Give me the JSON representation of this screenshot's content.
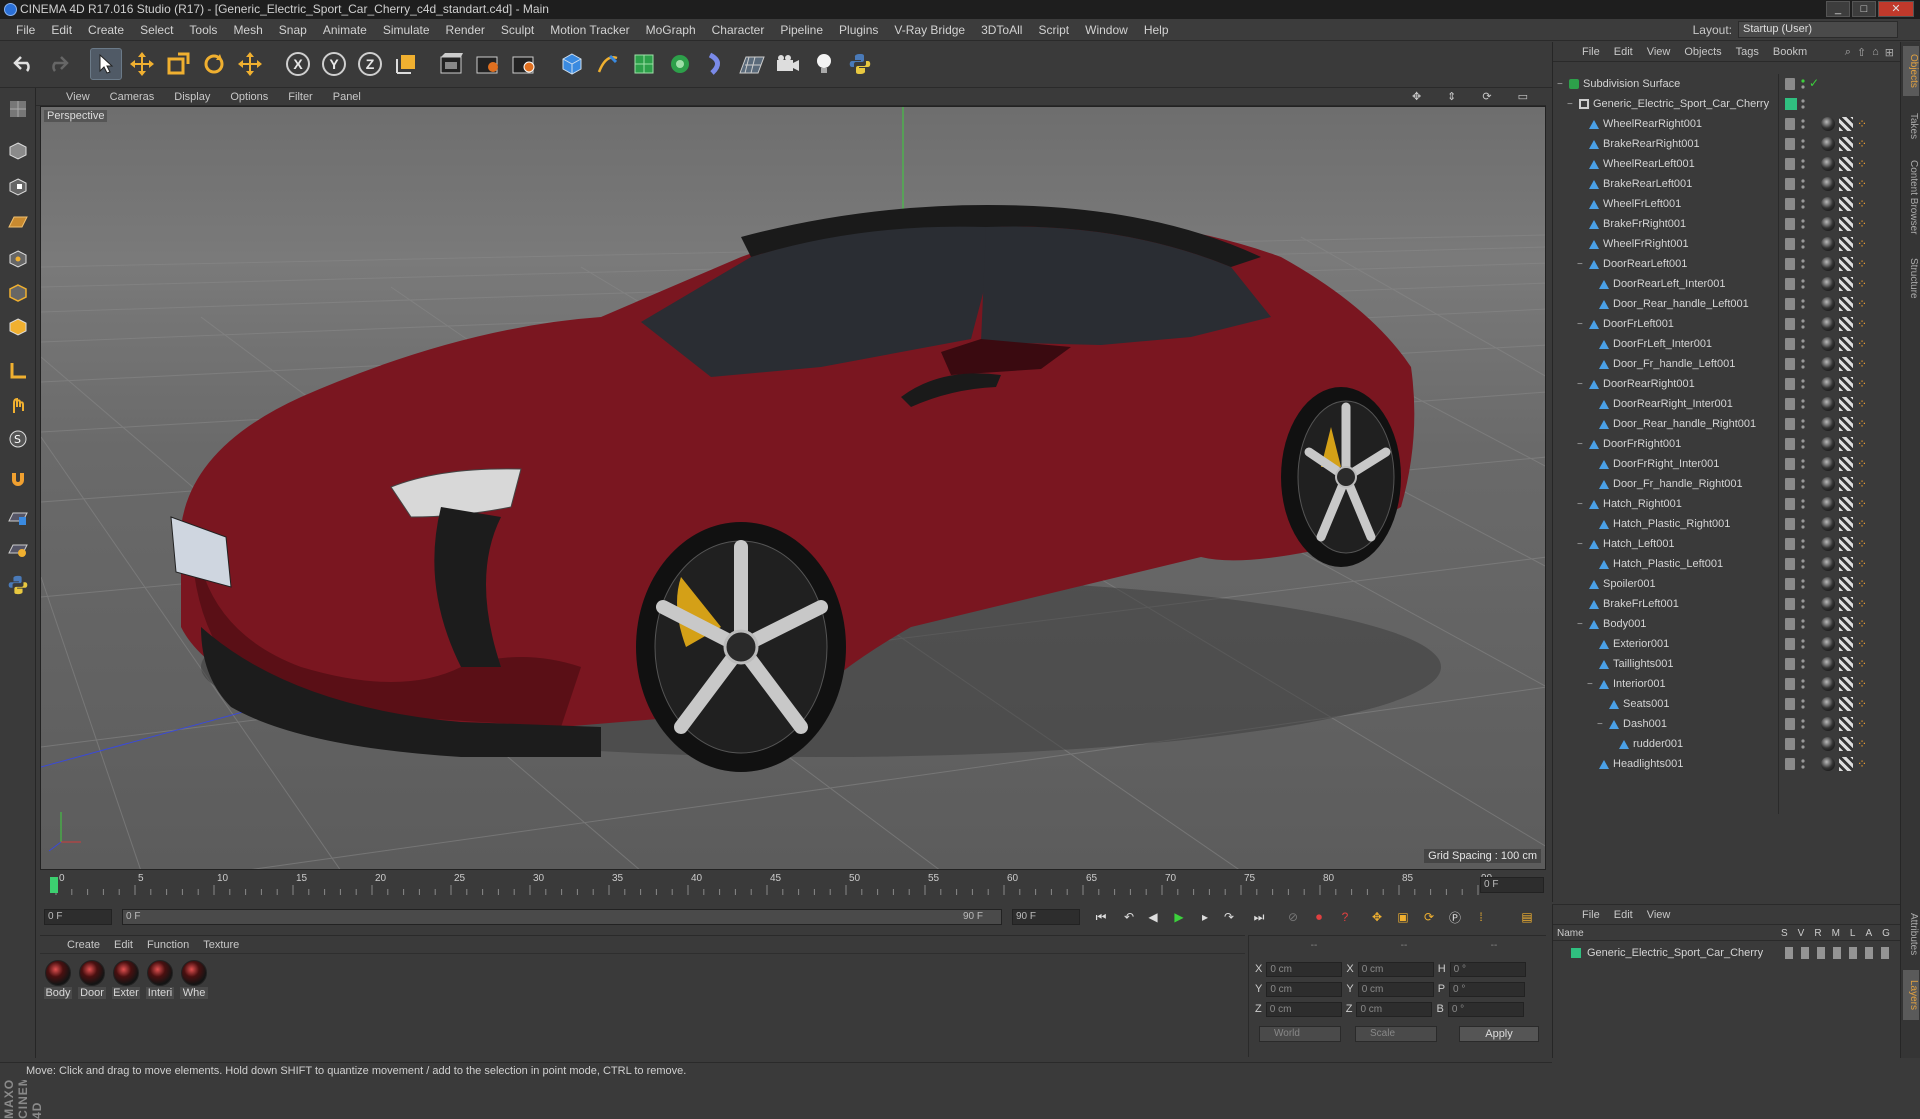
{
  "window": {
    "title": "CINEMA 4D R17.016 Studio (R17) - [Generic_Electric_Sport_Car_Cherry_c4d_standart.c4d] - Main",
    "buttons": [
      "_",
      "□",
      "✕"
    ]
  },
  "menubar": {
    "items": [
      "File",
      "Edit",
      "Create",
      "Select",
      "Tools",
      "Mesh",
      "Snap",
      "Animate",
      "Simulate",
      "Render",
      "Sculpt",
      "Motion Tracker",
      "MoGraph",
      "Character",
      "Pipeline",
      "Plugins",
      "V-Ray Bridge",
      "3DToAll",
      "Script",
      "Window",
      "Help"
    ],
    "layout_label": "Layout:",
    "layout_value": "Startup (User)"
  },
  "viewport": {
    "menu": [
      "View",
      "Cameras",
      "Display",
      "Options",
      "Filter",
      "Panel"
    ],
    "label": "Perspective",
    "grid_spacing": "Grid Spacing : 100 cm",
    "colors": {
      "car_body": "#7a1620",
      "car_dark": "#1a1a1a",
      "caliper": "#d4a017"
    }
  },
  "timeline": {
    "ticks": [
      "0",
      "5",
      "10",
      "15",
      "20",
      "25",
      "30",
      "35",
      "40",
      "45",
      "50",
      "55",
      "60",
      "65",
      "70",
      "75",
      "80",
      "85",
      "90"
    ],
    "end_field": "0 F",
    "current_frame": "0 F",
    "range_start": "0 F",
    "range_end": "90 F",
    "max_frame": "90 F"
  },
  "materials": {
    "menu": [
      "Create",
      "Edit",
      "Function",
      "Texture"
    ],
    "items": [
      "Body",
      "Door",
      "Exter",
      "Interi",
      "Whe"
    ]
  },
  "coordinates": {
    "header": [
      "--",
      "--",
      "--"
    ],
    "rows": [
      {
        "a": "X",
        "av": "0 cm",
        "b": "X",
        "bv": "0 cm",
        "c": "H",
        "cv": "0 °"
      },
      {
        "a": "Y",
        "av": "0 cm",
        "b": "Y",
        "bv": "0 cm",
        "c": "P",
        "cv": "0 °"
      },
      {
        "a": "Z",
        "av": "0 cm",
        "b": "Z",
        "bv": "0 cm",
        "c": "B",
        "cv": "0 °"
      }
    ],
    "world": "World",
    "scale": "Scale",
    "apply": "Apply"
  },
  "status": "Move: Click and drag to move elements. Hold down SHIFT to quantize movement / add to the selection in point mode, CTRL to remove.",
  "objects": {
    "menu": [
      "File",
      "Edit",
      "View",
      "Objects",
      "Tags",
      "Bookm"
    ],
    "items": [
      {
        "name": "Subdivision Surface",
        "depth": 0,
        "toggle": "−",
        "type": "subdiv"
      },
      {
        "name": "Generic_Electric_Sport_Car_Cherry",
        "depth": 1,
        "toggle": "−",
        "type": "null"
      },
      {
        "name": "WheelRearRight001",
        "depth": 2,
        "toggle": "",
        "type": "poly"
      },
      {
        "name": "BrakeRearRight001",
        "depth": 2,
        "toggle": "",
        "type": "poly"
      },
      {
        "name": "WheelRearLeft001",
        "depth": 2,
        "toggle": "",
        "type": "poly"
      },
      {
        "name": "BrakeRearLeft001",
        "depth": 2,
        "toggle": "",
        "type": "poly"
      },
      {
        "name": "WheelFrLeft001",
        "depth": 2,
        "toggle": "",
        "type": "poly"
      },
      {
        "name": "BrakeFrRight001",
        "depth": 2,
        "toggle": "",
        "type": "poly"
      },
      {
        "name": "WheelFrRight001",
        "depth": 2,
        "toggle": "",
        "type": "poly"
      },
      {
        "name": "DoorRearLeft001",
        "depth": 2,
        "toggle": "−",
        "type": "poly"
      },
      {
        "name": "DoorRearLeft_Inter001",
        "depth": 3,
        "toggle": "",
        "type": "poly"
      },
      {
        "name": "Door_Rear_handle_Left001",
        "depth": 3,
        "toggle": "",
        "type": "poly"
      },
      {
        "name": "DoorFrLeft001",
        "depth": 2,
        "toggle": "−",
        "type": "poly"
      },
      {
        "name": "DoorFrLeft_Inter001",
        "depth": 3,
        "toggle": "",
        "type": "poly"
      },
      {
        "name": "Door_Fr_handle_Left001",
        "depth": 3,
        "toggle": "",
        "type": "poly"
      },
      {
        "name": "DoorRearRight001",
        "depth": 2,
        "toggle": "−",
        "type": "poly"
      },
      {
        "name": "DoorRearRight_Inter001",
        "depth": 3,
        "toggle": "",
        "type": "poly"
      },
      {
        "name": "Door_Rear_handle_Right001",
        "depth": 3,
        "toggle": "",
        "type": "poly"
      },
      {
        "name": "DoorFrRight001",
        "depth": 2,
        "toggle": "−",
        "type": "poly"
      },
      {
        "name": "DoorFrRight_Inter001",
        "depth": 3,
        "toggle": "",
        "type": "poly"
      },
      {
        "name": "Door_Fr_handle_Right001",
        "depth": 3,
        "toggle": "",
        "type": "poly"
      },
      {
        "name": "Hatch_Right001",
        "depth": 2,
        "toggle": "−",
        "type": "poly"
      },
      {
        "name": "Hatch_Plastic_Right001",
        "depth": 3,
        "toggle": "",
        "type": "poly"
      },
      {
        "name": "Hatch_Left001",
        "depth": 2,
        "toggle": "−",
        "type": "poly"
      },
      {
        "name": "Hatch_Plastic_Left001",
        "depth": 3,
        "toggle": "",
        "type": "poly"
      },
      {
        "name": "Spoiler001",
        "depth": 2,
        "toggle": "",
        "type": "poly"
      },
      {
        "name": "BrakeFrLeft001",
        "depth": 2,
        "toggle": "",
        "type": "poly"
      },
      {
        "name": "Body001",
        "depth": 2,
        "toggle": "−",
        "type": "poly"
      },
      {
        "name": "Exterior001",
        "depth": 3,
        "toggle": "",
        "type": "poly"
      },
      {
        "name": "Taillights001",
        "depth": 3,
        "toggle": "",
        "type": "poly"
      },
      {
        "name": "Interior001",
        "depth": 3,
        "toggle": "−",
        "type": "poly"
      },
      {
        "name": "Seats001",
        "depth": 4,
        "toggle": "",
        "type": "poly"
      },
      {
        "name": "Dash001",
        "depth": 4,
        "toggle": "−",
        "type": "poly"
      },
      {
        "name": "rudder001",
        "depth": 5,
        "toggle": "",
        "type": "poly"
      },
      {
        "name": "Headlights001",
        "depth": 3,
        "toggle": "",
        "type": "poly"
      }
    ]
  },
  "layers": {
    "menu": [
      "File",
      "Edit",
      "View"
    ],
    "header_name": "Name",
    "header_cols": [
      "S",
      "V",
      "R",
      "M",
      "L",
      "A",
      "G"
    ],
    "items": [
      "Generic_Electric_Sport_Car_Cherry"
    ]
  },
  "right_tabs": [
    "Objects",
    "Takes",
    "Content Browser",
    "Structure",
    "Attributes",
    "Layers"
  ],
  "brand": "MAXON CINEMA 4D"
}
